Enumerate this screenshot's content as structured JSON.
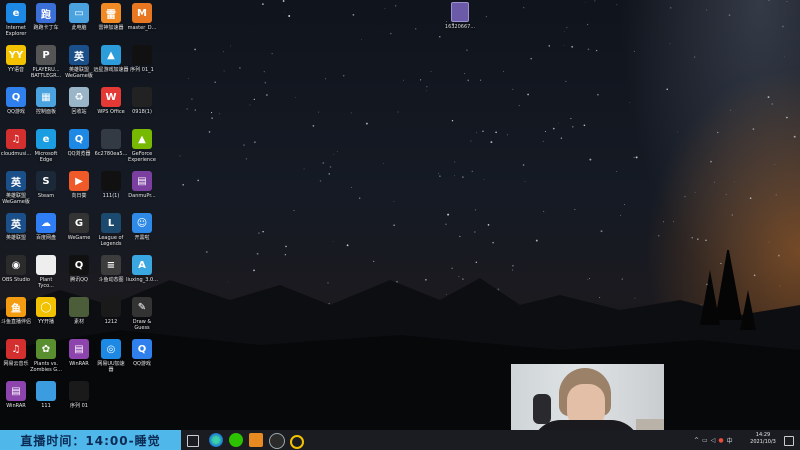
{
  "desktop_icons": [
    {
      "name": "internet-explorer",
      "label1": "Internet",
      "label2": "Explorer",
      "color": "#1e88e5",
      "glyph": "e"
    },
    {
      "name": "qq-speed",
      "label1": "跑跑卡丁车",
      "label2": "",
      "color": "#3a6fd8",
      "glyph": "跑"
    },
    {
      "name": "this-pc",
      "label1": "此电脑",
      "label2": "",
      "color": "#4aa3df",
      "glyph": "▭"
    },
    {
      "name": "thunder-accelerator",
      "label1": "雷神加速器",
      "label2": "",
      "color": "#f08a24",
      "glyph": "雷"
    },
    {
      "name": "master-d",
      "label1": "master_D...",
      "label2": "",
      "color": "#e87722",
      "glyph": "M"
    },
    {
      "name": "yy-voice",
      "label1": "YY语音",
      "label2": "",
      "color": "#f2c200",
      "glyph": "YY"
    },
    {
      "name": "pubg",
      "label1": "PLAYERU...",
      "label2": "BATTLEGR...",
      "color": "#555555",
      "glyph": "P"
    },
    {
      "name": "lol-wegame",
      "label1": "英雄联盟",
      "label2": "WeGame版",
      "color": "#1a4f8a",
      "glyph": "英"
    },
    {
      "name": "yuanjie-accelerator",
      "label1": "远星游戏加速器",
      "label2": "",
      "color": "#2d9cdb",
      "glyph": "▲"
    },
    {
      "name": "sequence-01-1",
      "label1": "序列 01_1",
      "label2": "",
      "color": "#111111",
      "glyph": ""
    },
    {
      "name": "qq-game-center",
      "label1": "QQ游戏",
      "label2": "",
      "color": "#2f80ed",
      "glyph": "Q"
    },
    {
      "name": "control-panel",
      "label1": "控制面板",
      "label2": "",
      "color": "#4aa3df",
      "glyph": "▦"
    },
    {
      "name": "recycle-bin",
      "label1": "回收站",
      "label2": "",
      "color": "#9ab4c8",
      "glyph": "♻"
    },
    {
      "name": "wps-office",
      "label1": "WPS Office",
      "label2": "",
      "color": "#e53935",
      "glyph": "W"
    },
    {
      "name": "file-0918",
      "label1": "0918(1)",
      "label2": "",
      "color": "#222222",
      "glyph": ""
    },
    {
      "name": "cloudmusic",
      "label1": "cloudmusi...",
      "label2": "",
      "color": "#d32f2f",
      "glyph": "♫"
    },
    {
      "name": "microsoft-edge",
      "label1": "Microsoft",
      "label2": "Edge",
      "color": "#1b9de2",
      "glyph": "e"
    },
    {
      "name": "qq-browser",
      "label1": "QQ浏览器",
      "label2": "",
      "color": "#1e88e5",
      "glyph": "Q"
    },
    {
      "name": "video-file",
      "label1": "6c2780ea5...",
      "label2": "",
      "color": "#333a44",
      "glyph": ""
    },
    {
      "name": "geforce-experience",
      "label1": "GeForce",
      "label2": "Experience",
      "color": "#76b900",
      "glyph": "▲"
    },
    {
      "name": "lol-wegame-2",
      "label1": "英雄联盟",
      "label2": "WeGame版",
      "color": "#1a4f8a",
      "glyph": "英"
    },
    {
      "name": "steam",
      "label1": "Steam",
      "label2": "",
      "color": "#1b2838",
      "glyph": "S"
    },
    {
      "name": "xiangrikui",
      "label1": "向日葵",
      "label2": "",
      "color": "#ef5a28",
      "glyph": "▶"
    },
    {
      "name": "file-111-1",
      "label1": "111(1)",
      "label2": "",
      "color": "#111111",
      "glyph": ""
    },
    {
      "name": "danmu",
      "label1": "DanmuPr...",
      "label2": "",
      "color": "#7b3fa0",
      "glyph": "▤"
    },
    {
      "name": "lol",
      "label1": "英雄联盟",
      "label2": "",
      "color": "#1a4f8a",
      "glyph": "英"
    },
    {
      "name": "baidu-netdisk",
      "label1": "百度网盘",
      "label2": "",
      "color": "#2f7ef5",
      "glyph": "☁"
    },
    {
      "name": "wegame",
      "label1": "WeGame",
      "label2": "",
      "color": "#333333",
      "glyph": "G"
    },
    {
      "name": "league-of-legends",
      "label1": "League of",
      "label2": "Legends",
      "color": "#1c4a6e",
      "glyph": "L"
    },
    {
      "name": "kaiheila",
      "label1": "开黑啦",
      "label2": "",
      "color": "#2e8ae6",
      "glyph": "☺"
    },
    {
      "name": "obs-studio",
      "label1": "OBS Studio",
      "label2": "",
      "color": "#2b2b2b",
      "glyph": "◉"
    },
    {
      "name": "plant-tycoon",
      "label1": "Plant",
      "label2": "Tyco...",
      "color": "#eeeeee",
      "glyph": ""
    },
    {
      "name": "tencent-qq",
      "label1": "腾讯QQ",
      "label2": "",
      "color": "#111111",
      "glyph": "Q"
    },
    {
      "name": "douyu-tool",
      "label1": "斗鱼动态图",
      "label2": "",
      "color": "#3c3c3c",
      "glyph": "≡"
    },
    {
      "name": "liuxing",
      "label1": "liuxing_3.0...",
      "label2": "",
      "color": "#3ba7e0",
      "glyph": "A"
    },
    {
      "name": "douyu-live",
      "label1": "斗鱼直播伴侣",
      "label2": "",
      "color": "#f39c12",
      "glyph": "鱼"
    },
    {
      "name": "yy-kaibo",
      "label1": "YY开播",
      "label2": "",
      "color": "#f2c200",
      "glyph": "◯"
    },
    {
      "name": "wallpaper",
      "label1": "素材",
      "label2": "",
      "color": "#4c5d3a",
      "glyph": ""
    },
    {
      "name": "file-1212",
      "label1": "1212",
      "label2": "",
      "color": "#1a1a1a",
      "glyph": ""
    },
    {
      "name": "draw-guess",
      "label1": "Draw &",
      "label2": "Guess",
      "color": "#333333",
      "glyph": "✎"
    },
    {
      "name": "netease-music",
      "label1": "网易云音乐",
      "label2": "",
      "color": "#d32f2f",
      "glyph": "♫"
    },
    {
      "name": "pvz",
      "label1": "Plants vs.",
      "label2": "Zombies G...",
      "color": "#5a8f2f",
      "glyph": "✿"
    },
    {
      "name": "winrar",
      "label1": "WinRAR",
      "label2": "",
      "color": "#8e44ad",
      "glyph": "▤"
    },
    {
      "name": "netease-uu",
      "label1": "网易UU加速",
      "label2": "器",
      "color": "#1e88e5",
      "glyph": "◎"
    },
    {
      "name": "qq-game",
      "label1": "QQ游戏",
      "label2": "",
      "color": "#2f80ed",
      "glyph": "Q"
    },
    {
      "name": "winrar-2",
      "label1": "WinRAR",
      "label2": "",
      "color": "#8e44ad",
      "glyph": "▤"
    },
    {
      "name": "file-111",
      "label1": "111",
      "label2": "",
      "color": "#3b9de0",
      "glyph": ""
    },
    {
      "name": "sequence-01",
      "label1": "序列 01",
      "label2": "",
      "color": "#1a1a1a",
      "glyph": ""
    }
  ],
  "desktop_file": {
    "label": "16320667..."
  },
  "live_banner": "直播时间：14:00-睡觉",
  "clock": {
    "time": "14:29",
    "date": "2021/10/3"
  },
  "taskbar_icons": [
    "task-view",
    "edge",
    "wechat",
    "app-orange",
    "obs",
    "app-yellow"
  ]
}
